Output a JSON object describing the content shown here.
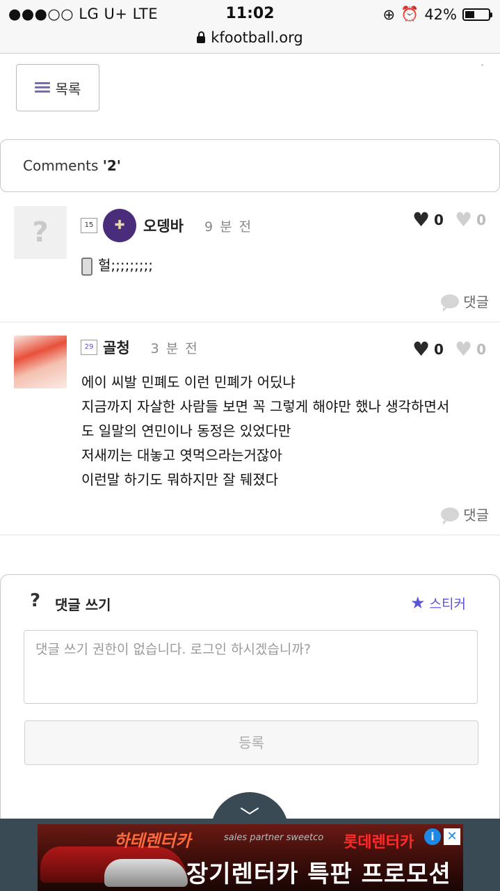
{
  "status": {
    "carrier": "●●●○○ LG U+   LTE",
    "time": "11:02",
    "battery": "42%",
    "battery_level": 0.42
  },
  "browser": {
    "url": "kfootball.org"
  },
  "list_button": {
    "label": "목록"
  },
  "comments_header": {
    "prefix": "Comments ",
    "count": "'2'"
  },
  "comments": [
    {
      "level": "15",
      "nickname": "오뎅바",
      "time": "9 분 전",
      "likes": "0",
      "dislikes": "0",
      "text": "헐;;;;;;;;;",
      "reply_label": "댓글"
    },
    {
      "level": "29",
      "nickname": "골청",
      "time": "3 분 전",
      "likes": "0",
      "dislikes": "0",
      "lines": [
        "에이 씨발 민폐도 이런 민폐가 어딨냐",
        "지금까지 자살한 사람들 보면 꼭 그렇게 해야만 했나 생각하면서",
        "도 일말의 연민이나 동정은 있었다만",
        "저새끼는 대놓고 엿먹으라는거잖아",
        "이런말 하기도 뭐하지만 잘 뒈졌다"
      ],
      "reply_label": "댓글"
    }
  ],
  "write": {
    "title": "댓글 쓰기",
    "sticker_label": "스티커",
    "placeholder": "댓글 쓰기 권한이 없습니다. 로그인 하시겠습니까?",
    "submit_label": "등록"
  },
  "ad": {
    "brand": "하테렌터카",
    "partner": "sales partner sweetco",
    "brand2": "롯데렌터카",
    "headline": "장기렌터카 특판 프로모션",
    "info": "i",
    "close": "✕"
  }
}
